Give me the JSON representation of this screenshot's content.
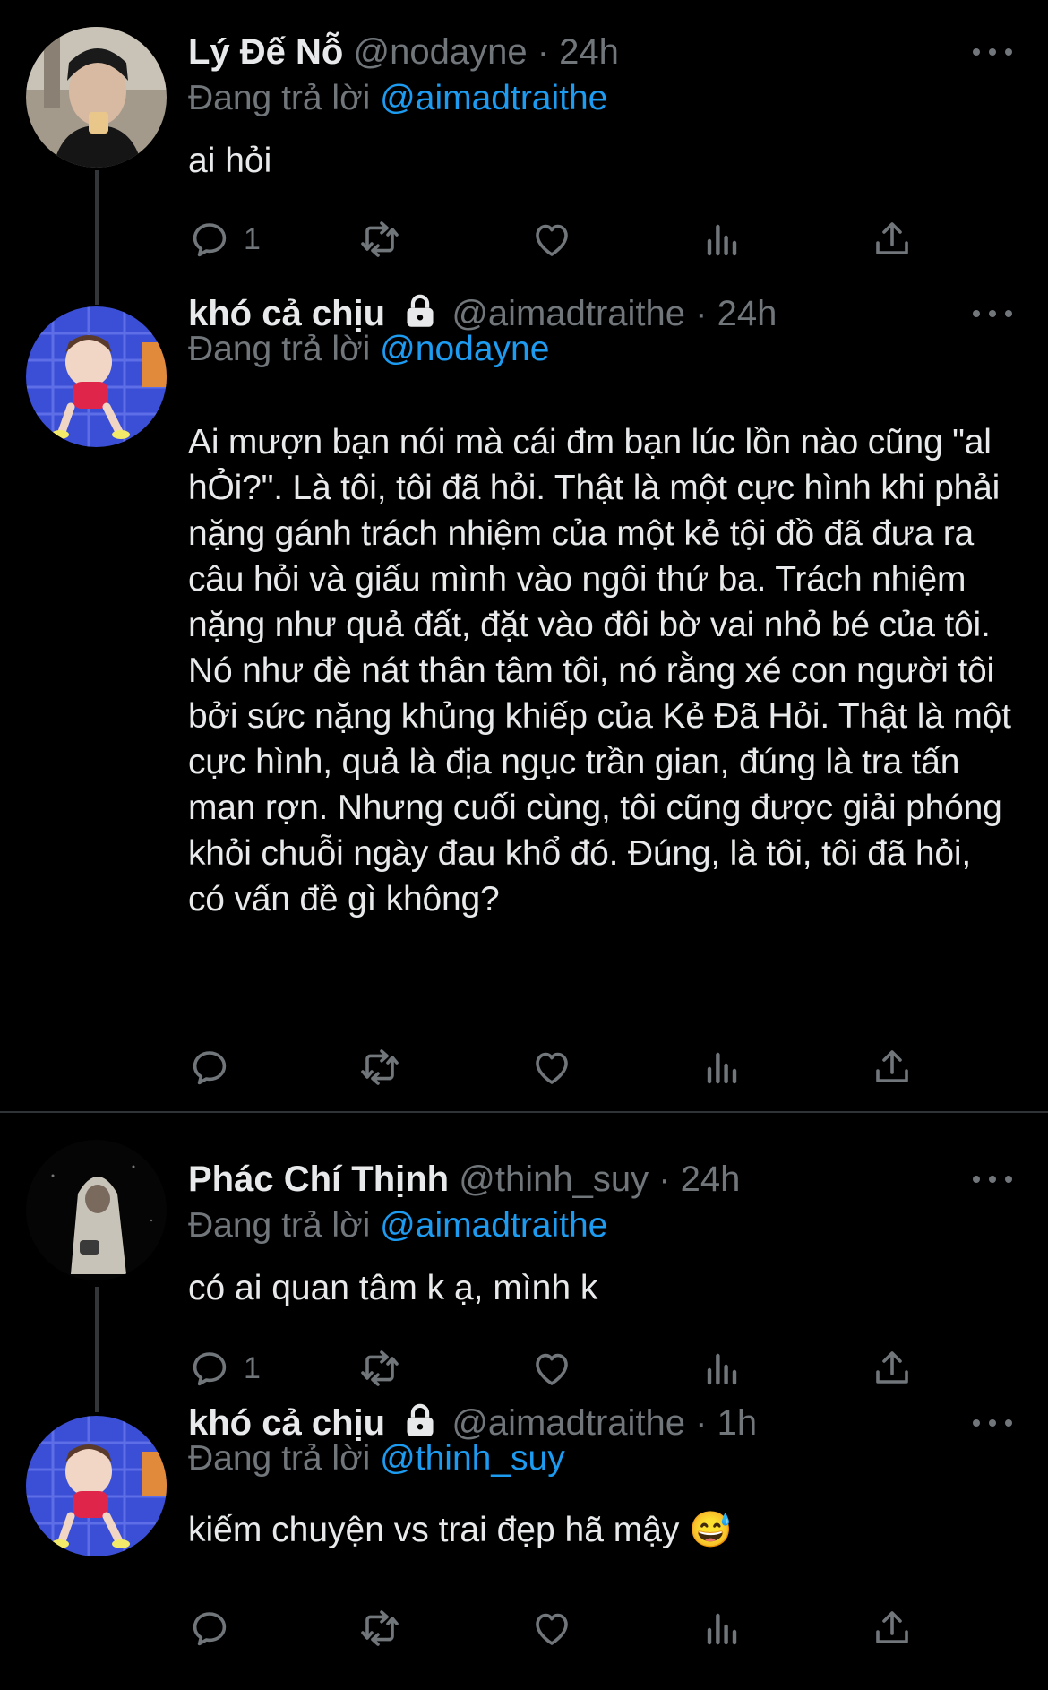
{
  "tweets": [
    {
      "name": "Lý Đế Nỗ",
      "handle": "@nodayne",
      "dot": "·",
      "time": "24h",
      "reply_prefix": "Đang trả lời",
      "reply_to": "@aimadtraithe",
      "text": "ai hỏi",
      "reply_count": "1",
      "locked": false
    },
    {
      "name": "khó cả chịu",
      "handle": "@aimadtraithe",
      "dot": "·",
      "time": "24h",
      "reply_prefix": "Đang trả lời",
      "reply_to": "@nodayne",
      "text": "Ai mượn bạn nói mà cái đm bạn lúc lồn nào cũng \"al hỎi?\". Là tôi, tôi đã hỏi. Thật là một cực hình khi phải nặng gánh trách nhiệm của một kẻ tội đồ đã đưa ra câu hỏi và giấu mình vào ngôi thứ ba. Trách nhiệm nặng như quả đất, đặt vào đôi bờ vai nhỏ bé của tôi. Nó như đè nát thân tâm tôi, nó rằng xé con người tôi bởi sức nặng khủng khiếp của Kẻ Đã Hỏi. Thật là một cực hình, quả là địa ngục trần gian, đúng là tra tấn man rợn. Nhưng cuối cùng, tôi cũng được giải phóng khỏi chuỗi ngày đau khổ đó. Đúng, là tôi, tôi đã hỏi, có vấn đề gì không?",
      "reply_count": "",
      "locked": true
    },
    {
      "name": "Phác Chí Thịnh",
      "handle": "@thinh_suy",
      "dot": "·",
      "time": "24h",
      "reply_prefix": "Đang trả lời",
      "reply_to": "@aimadtraithe",
      "text": "có ai quan tâm k ạ, mình k",
      "reply_count": "1",
      "locked": false
    },
    {
      "name": "khó cả chịu",
      "handle": "@aimadtraithe",
      "dot": "·",
      "time": "1h",
      "reply_prefix": "Đang trả lời",
      "reply_to": "@thinh_suy",
      "text": "kiếm chuyện vs trai đẹp hã mậy 😅",
      "reply_count": "",
      "locked": true
    }
  ],
  "icons": {
    "reply": "reply-icon",
    "retweet": "retweet-icon",
    "like": "heart-icon",
    "views": "views-icon",
    "share": "share-icon",
    "more": "more-icon",
    "lock": "lock-icon"
  },
  "colors": {
    "background": "#000000",
    "text": "#e7e9ea",
    "muted": "#71767b",
    "link": "#1d9bf0",
    "divider": "#2f3336"
  }
}
